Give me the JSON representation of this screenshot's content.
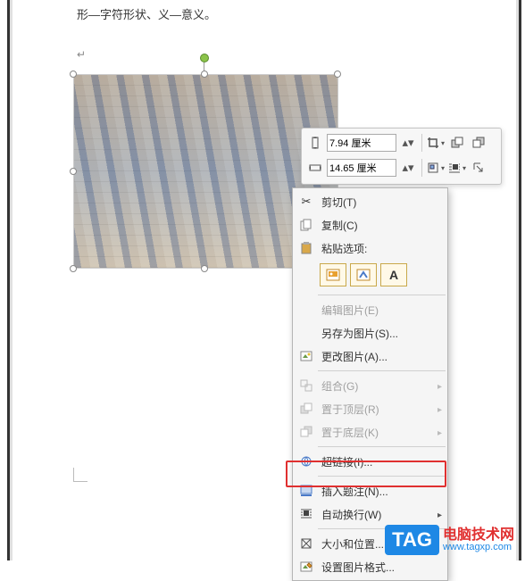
{
  "doc": {
    "line1": "形—字符形状、义—意义。",
    "para_mark": "↵"
  },
  "toolbar": {
    "height_value": "7.94 厘米",
    "width_value": "14.65 厘米"
  },
  "menu": {
    "cut": "剪切(T)",
    "copy": "复制(C)",
    "paste_header": "粘贴选项:",
    "paste_a": "A",
    "edit_picture": "编辑图片(E)",
    "save_as_picture": "另存为图片(S)...",
    "change_picture": "更改图片(A)...",
    "group": "组合(G)",
    "bring_front": "置于顶层(R)",
    "send_back": "置于底层(K)",
    "hyperlink": "超链接(I)...",
    "insert_caption": "插入题注(N)...",
    "wrap": "自动换行(W)",
    "size_pos": "大小和位置...",
    "format": "设置图片格式..."
  },
  "watermark": {
    "tag": "TAG",
    "cn": "电脑技术网",
    "url": "www.tagxp.com"
  }
}
